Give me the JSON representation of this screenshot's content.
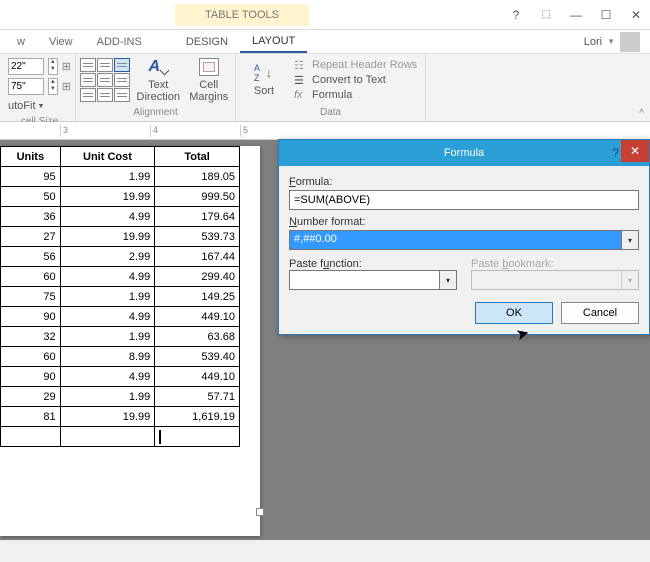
{
  "titlebar": {
    "contextual_title": "TABLE TOOLS"
  },
  "user": {
    "name": "Lori"
  },
  "tabs": {
    "t0": "w",
    "t1": "View",
    "t2": "ADD-INS",
    "t3": "DESIGN",
    "t4": "LAYOUT"
  },
  "sizegroup": {
    "h": "22\"",
    "w": "75\"",
    "autofit": "utoFit",
    "label": "cell Size"
  },
  "aligngroup": {
    "textdir": "Text Direction",
    "margins": "Cell Margins",
    "label": "Alignment"
  },
  "datagroup": {
    "sort": "Sort",
    "repeat": "Repeat Header Rows",
    "convert": "Convert to Text",
    "formula": "Formula",
    "label": "Data",
    "fx": "fx"
  },
  "ruler": {
    "m3": "3",
    "m4": "4",
    "m5": "5"
  },
  "table": {
    "headers": [
      "Units",
      "Unit Cost",
      "Total"
    ],
    "rows": [
      [
        "95",
        "1.99",
        "189.05"
      ],
      [
        "50",
        "19.99",
        "999.50"
      ],
      [
        "36",
        "4.99",
        "179.64"
      ],
      [
        "27",
        "19.99",
        "539.73"
      ],
      [
        "56",
        "2.99",
        "167.44"
      ],
      [
        "60",
        "4.99",
        "299.40"
      ],
      [
        "75",
        "1.99",
        "149.25"
      ],
      [
        "90",
        "4.99",
        "449.10"
      ],
      [
        "32",
        "1.99",
        "63.68"
      ],
      [
        "60",
        "8.99",
        "539.40"
      ],
      [
        "90",
        "4.99",
        "449.10"
      ],
      [
        "29",
        "1.99",
        "57.71"
      ],
      [
        "81",
        "19.99",
        "1,619.19"
      ]
    ]
  },
  "dialog": {
    "title": "Formula",
    "formula_label": "Formula:",
    "formula_value": "=SUM(ABOVE)",
    "numfmt_label": "Number format:",
    "numfmt_value": "#,##0.00",
    "pastefn_label": "Paste function:",
    "pastebm_label": "Paste bookmark:",
    "ok": "OK",
    "cancel": "Cancel"
  }
}
